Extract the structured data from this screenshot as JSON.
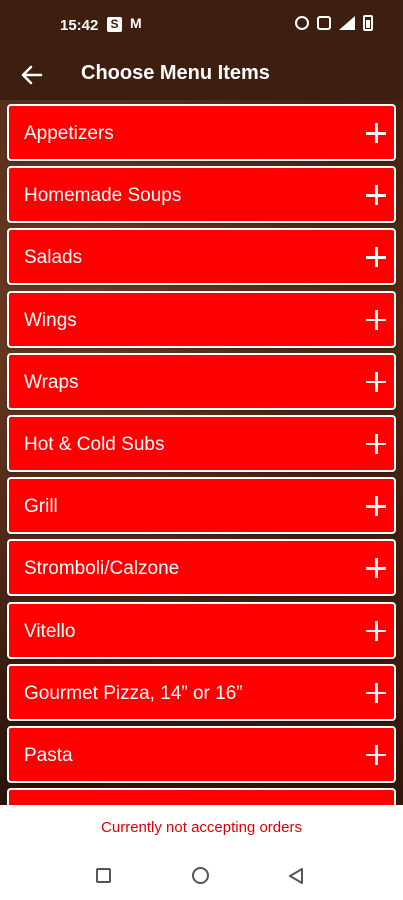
{
  "status": {
    "time": "15:42",
    "icons": [
      "s-app-icon",
      "gmail-icon",
      "alarm-icon",
      "vibrate-icon",
      "wifi-icon",
      "battery-icon"
    ]
  },
  "appbar": {
    "title": "Choose Menu Items",
    "back_icon": "arrow-left-icon"
  },
  "menu": {
    "items": [
      {
        "label": "Appetizers"
      },
      {
        "label": "Homemade Soups"
      },
      {
        "label": "Salads"
      },
      {
        "label": "Wings"
      },
      {
        "label": "Wraps"
      },
      {
        "label": "Hot & Cold Subs"
      },
      {
        "label": "Grill"
      },
      {
        "label": "Stromboli/Calzone"
      },
      {
        "label": "Vitello"
      },
      {
        "label": "Gourmet Pizza, 14” or 16”"
      },
      {
        "label": "Pasta"
      }
    ],
    "accent_color": "#ff0000"
  },
  "footer": {
    "notice": "Currently not accepting orders"
  }
}
